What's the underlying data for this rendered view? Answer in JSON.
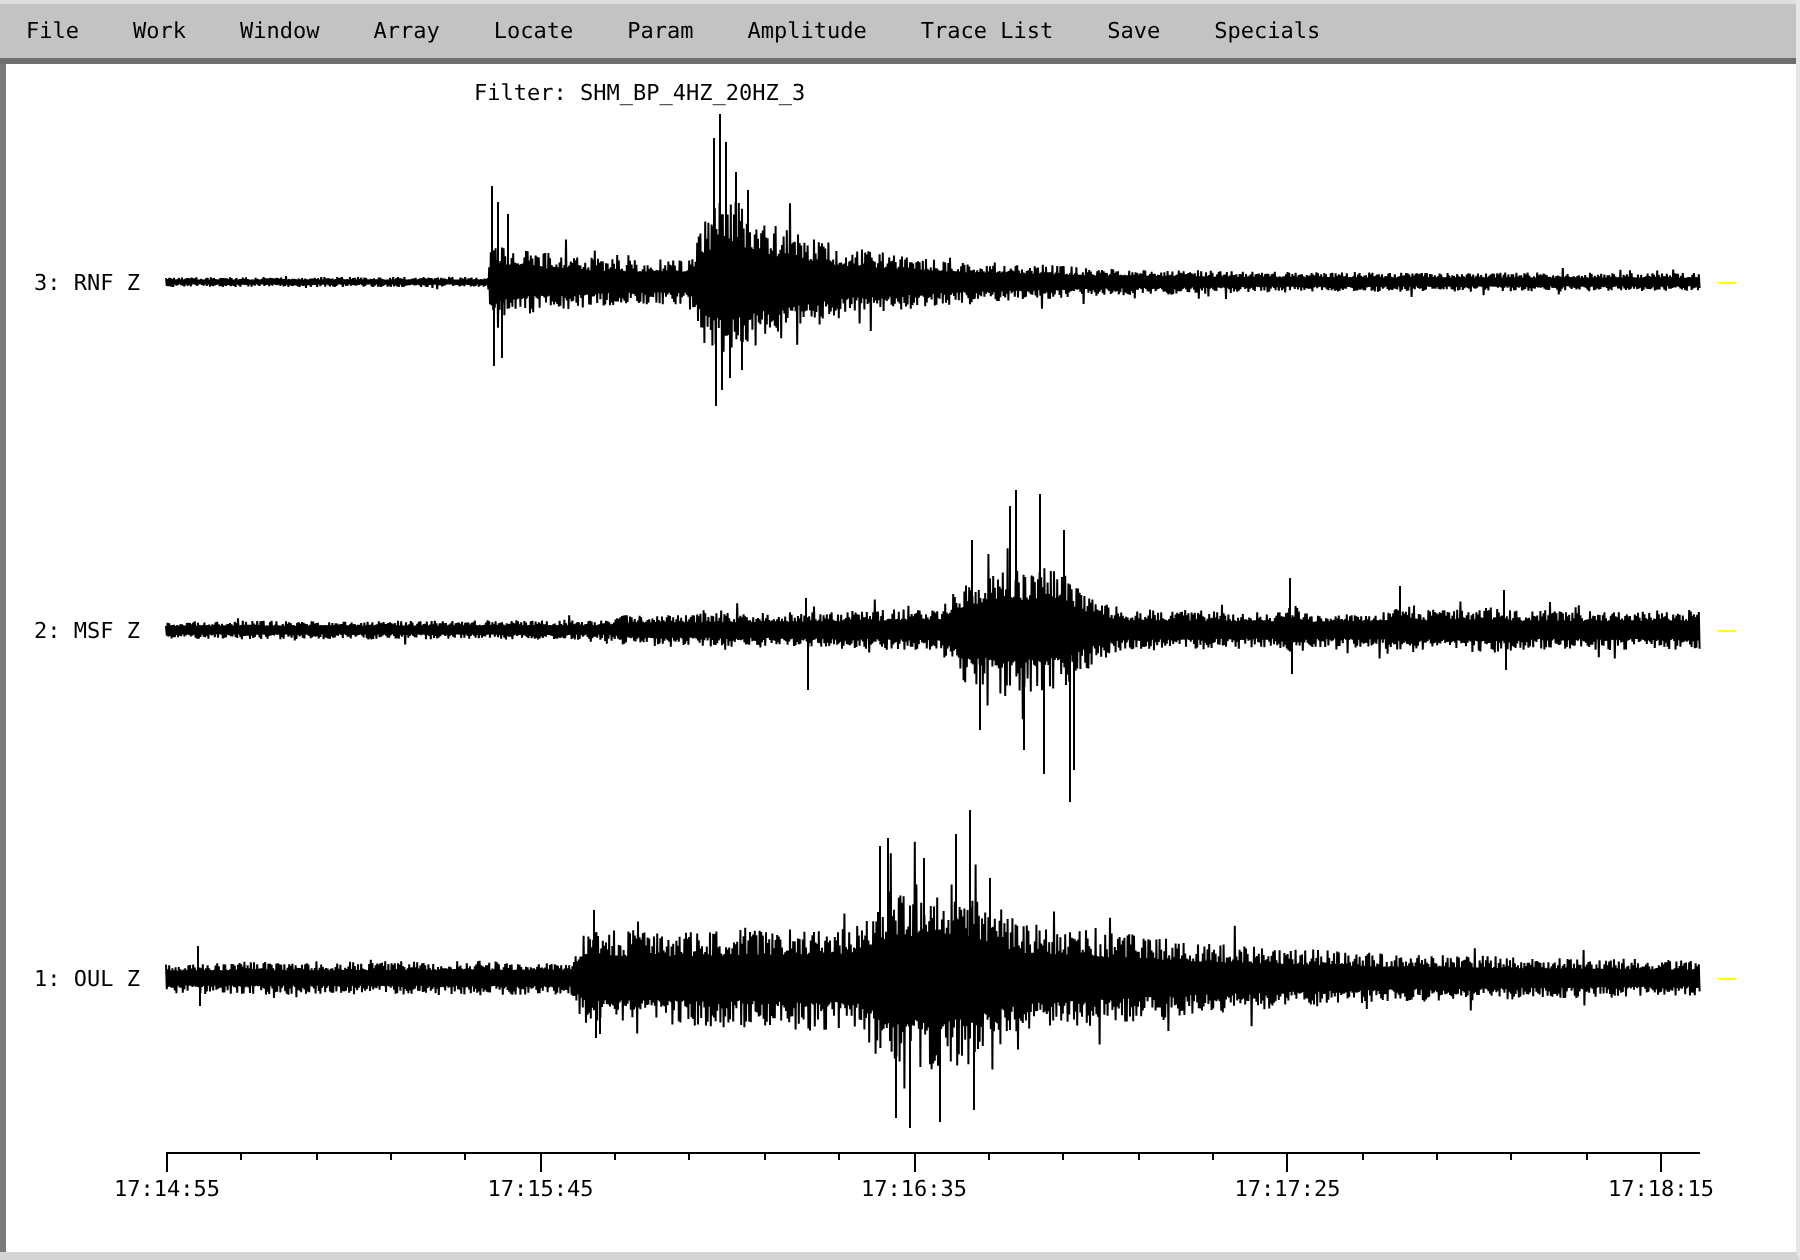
{
  "menu_bar": {
    "items": [
      "File",
      "Work",
      "Window",
      "Array",
      "Locate",
      "Param",
      "Amplitude",
      "Trace List",
      "Save",
      "Specials"
    ]
  },
  "plot": {
    "filter_label": "Filter: SHM_BP_4HZ_20HZ_3",
    "traces": [
      {
        "label": "3: RNF Z"
      },
      {
        "label": "2: MSF Z"
      },
      {
        "label": "1: OUL Z"
      }
    ],
    "time_axis": {
      "labels": [
        "17:14:55",
        "17:15:45",
        "17:16:35",
        "17:17:25",
        "17:18:15"
      ]
    }
  }
}
